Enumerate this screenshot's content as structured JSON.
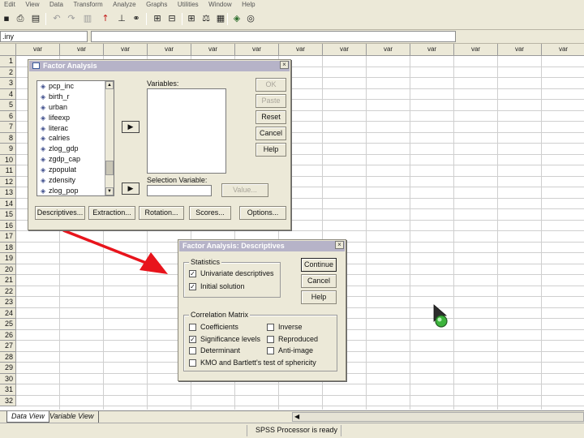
{
  "menubar": {
    "items": [
      "Edit",
      "View",
      "Data",
      "Transform",
      "Analyze",
      "Graphs",
      "Utilities",
      "Window",
      "Help"
    ]
  },
  "editbar": {
    "cell_ref": ".iny",
    "cell_value": ""
  },
  "grid": {
    "column_header": "var",
    "column_count": 13,
    "rows": [
      "1",
      "2",
      "3",
      "4",
      "5",
      "6",
      "7",
      "8",
      "9",
      "10",
      "11",
      "12",
      "13",
      "14",
      "15",
      "16",
      "17",
      "18",
      "19",
      "20",
      "21",
      "22",
      "23",
      "24",
      "25",
      "26",
      "27",
      "28",
      "29",
      "30",
      "31",
      "32"
    ]
  },
  "factor_dialog": {
    "title": "Factor Analysis",
    "variables_list": [
      "pcp_inc",
      "birth_r",
      "urban",
      "lifeexp",
      "literac",
      "calries",
      "zlog_gdp",
      "zgdp_cap",
      "zpopulat",
      "zdensity",
      "zlog_pop"
    ],
    "variables_label": "Variables:",
    "selection_label": "Selection Variable:",
    "value_button": "Value...",
    "buttons": {
      "ok": "OK",
      "paste": "Paste",
      "reset": "Reset",
      "cancel": "Cancel",
      "help": "Help"
    },
    "bottom_buttons": [
      "Descriptives...",
      "Extraction...",
      "Rotation...",
      "Scores...",
      "Options..."
    ]
  },
  "desc_dialog": {
    "title": "Factor Analysis: Descriptives",
    "statistics_legend": "Statistics",
    "univariate_label": "Univariate descriptives",
    "univariate_checked": true,
    "initial_label": "Initial solution",
    "initial_checked": true,
    "correlation_legend": "Correlation Matrix",
    "coefficients_label": "Coefficients",
    "coefficients_checked": false,
    "inverse_label": "Inverse",
    "inverse_checked": false,
    "significance_label": "Significance levels",
    "significance_checked": true,
    "reproduced_label": "Reproduced",
    "reproduced_checked": false,
    "determinant_label": "Determinant",
    "determinant_checked": false,
    "antiimage_label": "Anti-image",
    "antiimage_checked": false,
    "kmo_label": "KMO and Bartlett's test of sphericity",
    "kmo_checked": false,
    "buttons": {
      "continue": "Continue",
      "cancel": "Cancel",
      "help": "Help"
    }
  },
  "tabs": {
    "data_view": "Data View",
    "variable_view": "Variable View"
  },
  "status": {
    "message": "SPSS Processor  is ready"
  },
  "colors": {
    "dialog_bg": "#ece9d8",
    "title_bar": "#b6b3c8",
    "arrow": "#e8141c",
    "cursor": "#3cb43c"
  },
  "icons": [
    "save-icon",
    "print-icon",
    "dialog-recall-icon",
    "undo-icon",
    "redo-icon",
    "goto-chart-icon",
    "goto-case-icon",
    "variables-icon",
    "find-icon",
    "insert-case-icon",
    "insert-variable-icon",
    "split-file-icon",
    "weight-cases-icon",
    "select-cases-icon",
    "value-labels-icon",
    "use-sets-icon"
  ]
}
